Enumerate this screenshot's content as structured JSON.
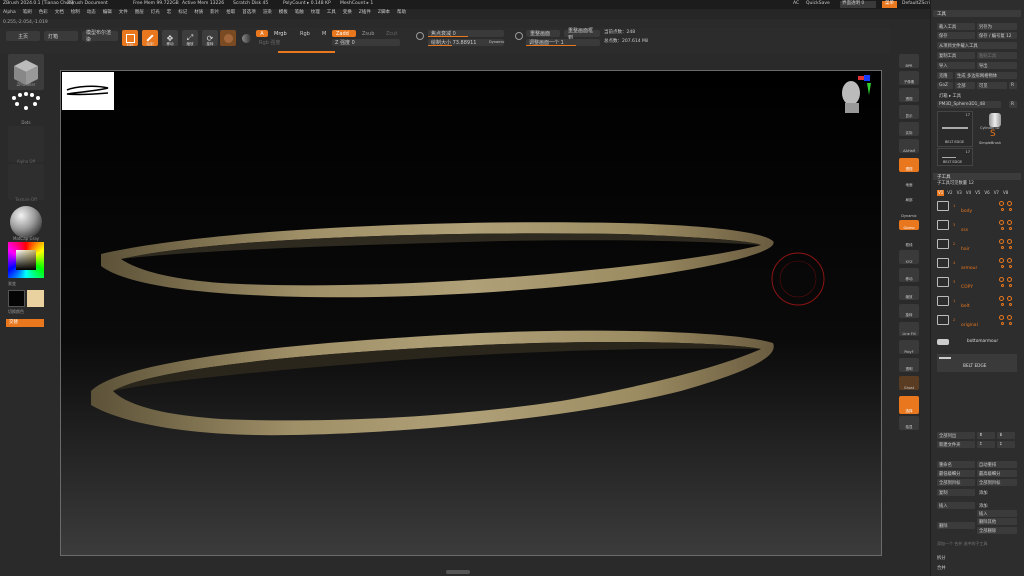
{
  "titlebar": {
    "items": [
      "ZBrush 2024.0.1 [Tianao Chen]",
      "ZBrush Document",
      "Free Mem 99.722GB",
      "Active Mem 13226",
      "Scratch Disk 45",
      "PolyCount ▸ 0.148 KP",
      "MeshCount ▸ 1"
    ],
    "right": [
      "AC",
      "QuickSave",
      "界面透明 0",
      "菜单",
      "DefaultZScript"
    ]
  },
  "menubar": {
    "items": [
      "Alpha",
      "笔刷",
      "色彩",
      "文档",
      "绘制",
      "动态",
      "编辑",
      "文件",
      "图层",
      "灯光",
      "宏",
      "标记",
      "材质",
      "影片",
      "拾取",
      "首选项",
      "渲染",
      "模板",
      "笔触",
      "纹理",
      "工具",
      "变换",
      "Z插件",
      "Z脚本",
      "帮助"
    ]
  },
  "coords": "0.255,-2.054,-1.019",
  "toptool": {
    "home_tab": "主页",
    "lightbox": "灯箱",
    "live_boolean": "模型布尔渲染",
    "edit": "Edit",
    "draw": "绘制",
    "move": "移动",
    "scale": "缩放",
    "rotate": "旋转",
    "a_btn": "A",
    "mrgb": "Mrgb",
    "rgb": "Rgb",
    "m": "M",
    "zadd": "Zadd",
    "zsub": "Zsub",
    "zcut": "Zcut",
    "rgb_intensity": "Rgb 强度",
    "z_intensity": "Z 强度 0",
    "focal_shift": "焦点衰减 0",
    "draw_size": "绘制大小 73.88911",
    "dynamic": "Dynamic",
    "redraw": "重整画面",
    "redraw2": "重整画面框到",
    "adjust": "调整画面一个 1",
    "active_points": "当前点数：248",
    "total_points": "总点数：207.614 Mil"
  },
  "leftshelf": {
    "brush": "ZModeler",
    "stroke": "Dots",
    "alpha": "Alpha Off",
    "texture": "Texture Off",
    "material": "MatCap Gray",
    "gradient": "渐变",
    "swatch": "切换颜色",
    "alternate": "交替"
  },
  "rightshelf": {
    "items": [
      "BPR",
      "子像素",
      "透视",
      "显示",
      "实际",
      "AAHalf",
      "透视",
      "地面",
      "局部",
      "Dynamic",
      "Gizmo",
      "框线",
      "XYZ",
      "移动",
      "缩放",
      "旋转",
      "Line Fill",
      "PolyF",
      "透明",
      "Ghost",
      "选择",
      "独显"
    ]
  },
  "toolpanel": {
    "title": "工具",
    "load": "载入工具",
    "save_as": "另存为",
    "copy": "保存",
    "save_default": "保存 / 编号复 12",
    "load_from": "从项目文件载入工具",
    "copy_tool": "复制工具",
    "paste_tool": "粘贴工具",
    "import": "导入",
    "export": "导出",
    "clone": "克隆",
    "make_polymesh": "生成 多边形网格物体",
    "goz": "GoZ",
    "all": "全部",
    "visible": "可见",
    "r": "R",
    "lightbox_tools": "灯箱 ▸ 工具",
    "current_tool": "PM3D_Sphere3D1_48",
    "tool_count": "48",
    "r2": "R",
    "thumb1_count": "17",
    "thumb1_label": "BELT EDGE",
    "thumb2_label": "Cylinder3D",
    "thumb3_label": "SimpleBrush",
    "thumb4_count": "17",
    "thumb4_label": "BELT EDGE",
    "subtool_head": "子工具",
    "subtool_count": "子工具可见数量 12",
    "versions": [
      "V1",
      "V2",
      "V3",
      "V4",
      "V5",
      "V6",
      "V7",
      "V8"
    ],
    "subtools": [
      {
        "idx": "1",
        "name": "body"
      },
      {
        "idx": "3",
        "name": "sss"
      },
      {
        "idx": "2",
        "name": "hair"
      },
      {
        "idx": "4",
        "name": "armour"
      },
      {
        "idx": "3",
        "name": "COPY"
      },
      {
        "idx": "1",
        "name": "belt"
      },
      {
        "idx": "2",
        "name": "original"
      }
    ],
    "bottom_armor": "bottomarmour",
    "belt_edge_row": "BELT EDGE",
    "list_all": "全部列出",
    "new_folder": "新建文件夹",
    "rename": "重命名",
    "auto_rename": "自动重排",
    "all_low": "最低级细分",
    "all_high": "最高级细分",
    "copy_sub": "全部到目标",
    "all_to": "全部到目标",
    "duplicate": "复制",
    "append": "添加",
    "insert": "插入",
    "delete": "删除",
    "del_other": "删除其他",
    "del_all": "全部删除",
    "hint": "添加一个 合并 选中的子工具",
    "split": "拆分",
    "merge": "合并"
  },
  "canvas": {
    "stroke_preview": "stroke-preview"
  }
}
